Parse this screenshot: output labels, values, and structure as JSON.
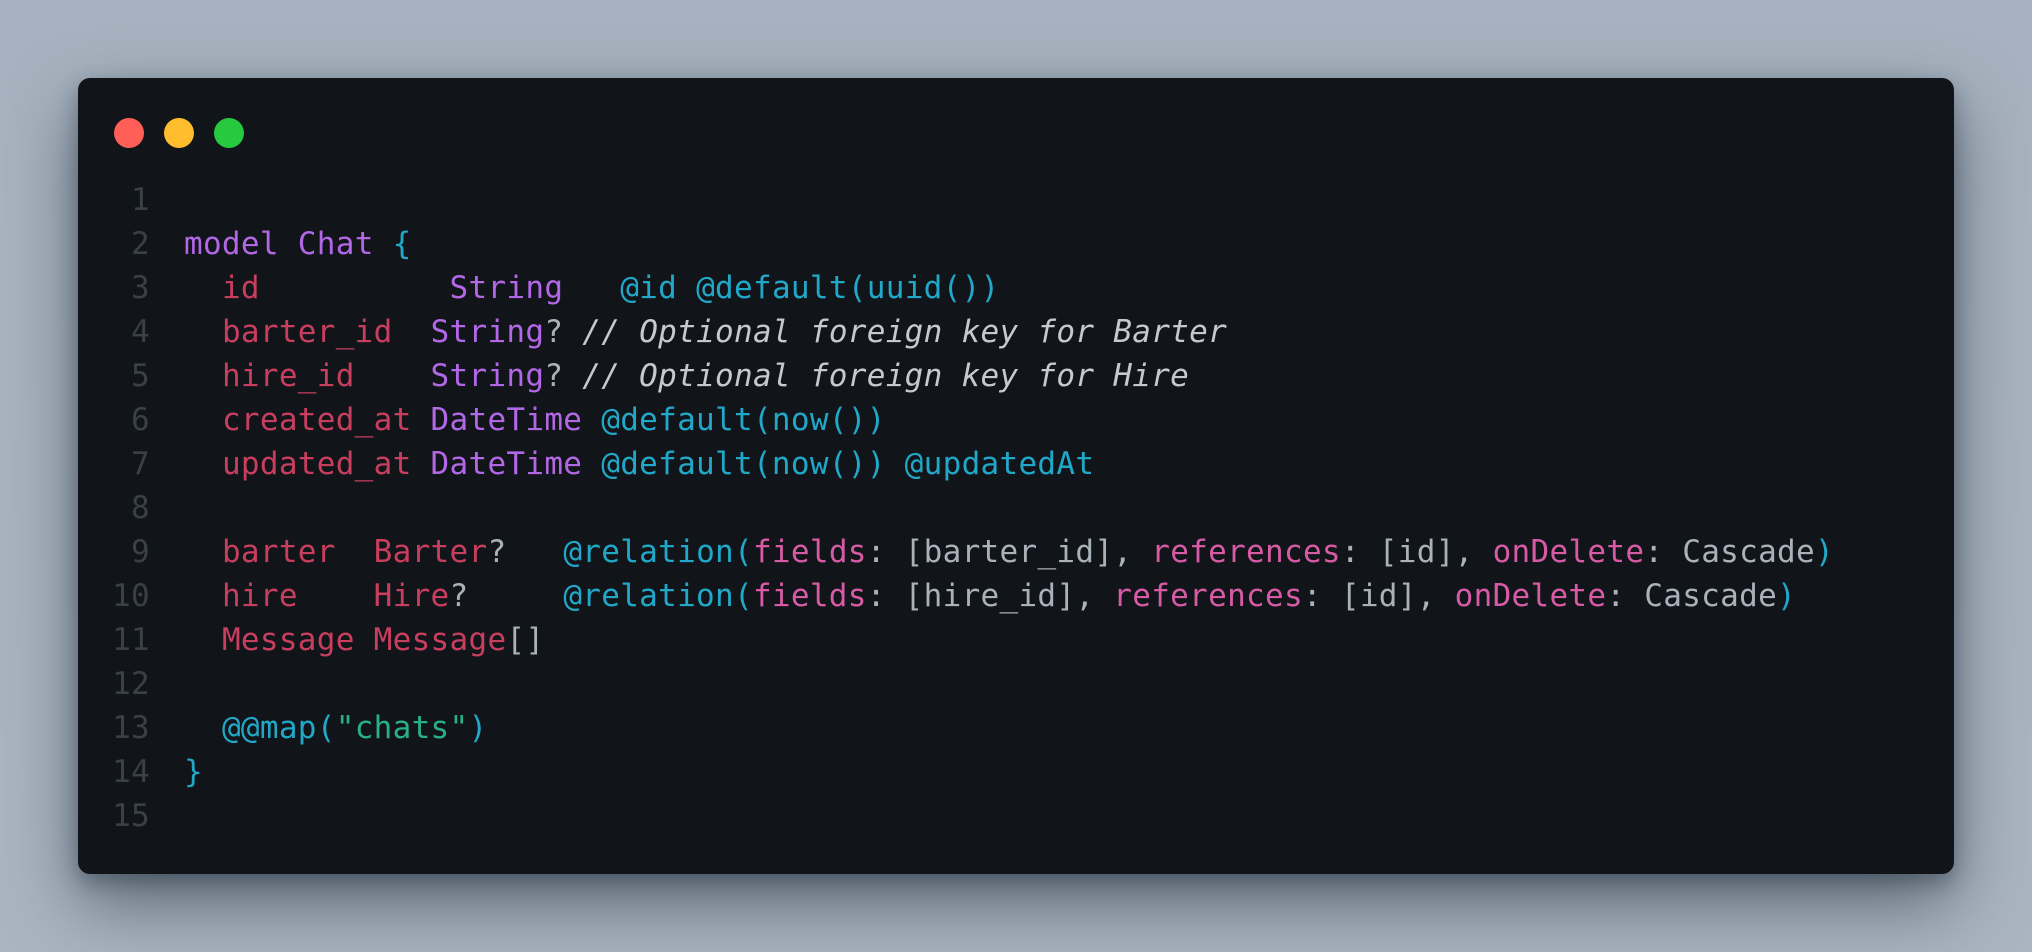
{
  "window": {
    "controls": [
      "close",
      "minimize",
      "maximize"
    ]
  },
  "code": {
    "line_numbers": [
      "1",
      "2",
      "3",
      "4",
      "5",
      "6",
      "7",
      "8",
      "9",
      "10",
      "11",
      "12",
      "13",
      "14",
      "15"
    ],
    "lines": [
      [],
      [
        {
          "t": "model",
          "c": "kw"
        },
        {
          "t": " ",
          "c": "plain"
        },
        {
          "t": "Chat",
          "c": "typ"
        },
        {
          "t": " ",
          "c": "plain"
        },
        {
          "t": "{",
          "c": "cyan"
        }
      ],
      [
        {
          "t": "  ",
          "c": "plain"
        },
        {
          "t": "id",
          "c": "fld"
        },
        {
          "t": "          ",
          "c": "plain"
        },
        {
          "t": "String",
          "c": "typ"
        },
        {
          "t": "   ",
          "c": "plain"
        },
        {
          "t": "@id",
          "c": "cyan"
        },
        {
          "t": " ",
          "c": "plain"
        },
        {
          "t": "@default(uuid())",
          "c": "cyan"
        }
      ],
      [
        {
          "t": "  ",
          "c": "plain"
        },
        {
          "t": "barter_id",
          "c": "fld"
        },
        {
          "t": "  ",
          "c": "plain"
        },
        {
          "t": "String",
          "c": "typ"
        },
        {
          "t": "? ",
          "c": "plain"
        },
        {
          "t": "// Optional foreign key for Barter",
          "c": "cmt"
        }
      ],
      [
        {
          "t": "  ",
          "c": "plain"
        },
        {
          "t": "hire_id",
          "c": "fld"
        },
        {
          "t": "    ",
          "c": "plain"
        },
        {
          "t": "String",
          "c": "typ"
        },
        {
          "t": "? ",
          "c": "plain"
        },
        {
          "t": "// Optional foreign key for Hire",
          "c": "cmt"
        }
      ],
      [
        {
          "t": "  ",
          "c": "plain"
        },
        {
          "t": "created_at",
          "c": "fld"
        },
        {
          "t": " ",
          "c": "plain"
        },
        {
          "t": "DateTime",
          "c": "typ"
        },
        {
          "t": " ",
          "c": "plain"
        },
        {
          "t": "@default(now())",
          "c": "cyan"
        }
      ],
      [
        {
          "t": "  ",
          "c": "plain"
        },
        {
          "t": "updated_at",
          "c": "fld"
        },
        {
          "t": " ",
          "c": "plain"
        },
        {
          "t": "DateTime",
          "c": "typ"
        },
        {
          "t": " ",
          "c": "plain"
        },
        {
          "t": "@default(now())",
          "c": "cyan"
        },
        {
          "t": " ",
          "c": "plain"
        },
        {
          "t": "@updatedAt",
          "c": "cyan"
        }
      ],
      [],
      [
        {
          "t": "  ",
          "c": "plain"
        },
        {
          "t": "barter",
          "c": "fld"
        },
        {
          "t": "  ",
          "c": "plain"
        },
        {
          "t": "Barter",
          "c": "fld"
        },
        {
          "t": "?   ",
          "c": "plain"
        },
        {
          "t": "@relation(",
          "c": "cyan"
        },
        {
          "t": "fields",
          "c": "arg"
        },
        {
          "t": ": [barter_id], ",
          "c": "plain"
        },
        {
          "t": "references",
          "c": "arg"
        },
        {
          "t": ": [id], ",
          "c": "plain"
        },
        {
          "t": "onDelete",
          "c": "arg"
        },
        {
          "t": ": Cascade",
          "c": "plain"
        },
        {
          "t": ")",
          "c": "cyan"
        }
      ],
      [
        {
          "t": "  ",
          "c": "plain"
        },
        {
          "t": "hire",
          "c": "fld"
        },
        {
          "t": "    ",
          "c": "plain"
        },
        {
          "t": "Hire",
          "c": "fld"
        },
        {
          "t": "?     ",
          "c": "plain"
        },
        {
          "t": "@relation(",
          "c": "cyan"
        },
        {
          "t": "fields",
          "c": "arg"
        },
        {
          "t": ": [hire_id], ",
          "c": "plain"
        },
        {
          "t": "references",
          "c": "arg"
        },
        {
          "t": ": [id], ",
          "c": "plain"
        },
        {
          "t": "onDelete",
          "c": "arg"
        },
        {
          "t": ": Cascade",
          "c": "plain"
        },
        {
          "t": ")",
          "c": "cyan"
        }
      ],
      [
        {
          "t": "  ",
          "c": "plain"
        },
        {
          "t": "Message",
          "c": "fld"
        },
        {
          "t": " ",
          "c": "plain"
        },
        {
          "t": "Message",
          "c": "fld"
        },
        {
          "t": "[]",
          "c": "plain"
        }
      ],
      [],
      [
        {
          "t": "  ",
          "c": "plain"
        },
        {
          "t": "@@map(",
          "c": "cyan"
        },
        {
          "t": "\"chats\"",
          "c": "str"
        },
        {
          "t": ")",
          "c": "cyan"
        }
      ],
      [
        {
          "t": "}",
          "c": "cyan"
        }
      ],
      []
    ]
  },
  "colors": {
    "background": "#a6b2bf",
    "window": "#111418",
    "close": "#ff5f56",
    "minimize": "#ffbd2e",
    "maximize": "#27c93f",
    "keyword": "#b267e6",
    "field": "#c83e5f",
    "attribute": "#21a8c9",
    "argument": "#d65ba4",
    "string": "#28b08a",
    "line_number": "#3a4048"
  }
}
